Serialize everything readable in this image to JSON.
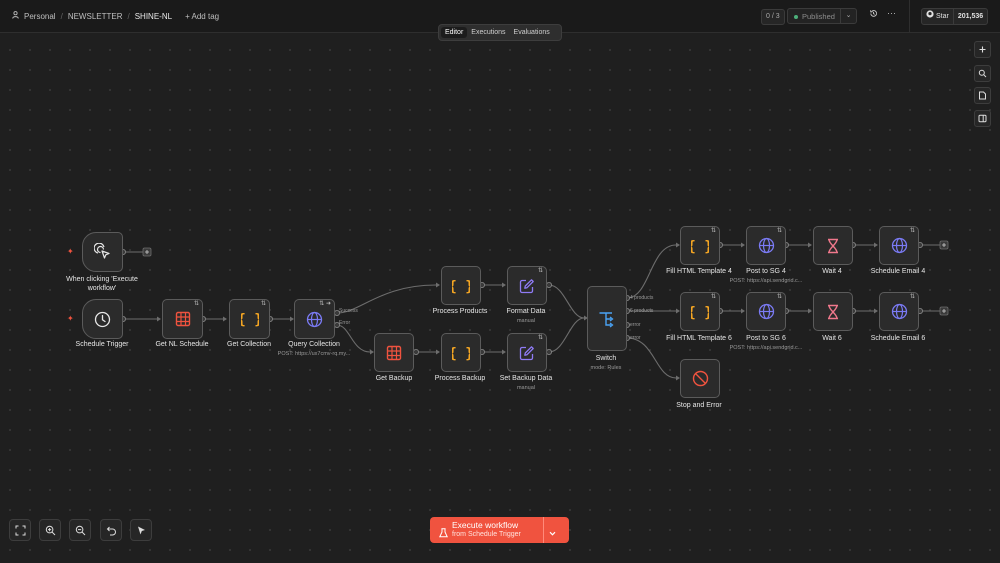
{
  "breadcrumb": {
    "personal": "Personal",
    "project": "NEWSLETTER",
    "workflow": "SHINE-NL",
    "add_tag": "+ Add tag"
  },
  "header": {
    "counter": "0 / 3",
    "publish_label": "Published",
    "github_star_label": "Star",
    "github_star_count": "201,536"
  },
  "view_tabs": {
    "editor": "Editor",
    "executions": "Executions",
    "evaluations": "Evaluations",
    "active": "Editor"
  },
  "execute_button": {
    "label": "Execute workflow",
    "sublabel": "from Schedule Trigger"
  },
  "nodes": {
    "manual_trigger": {
      "label": "When clicking 'Execute workflow'",
      "icon": "pointer-click-icon"
    },
    "schedule_trigger": {
      "label": "Schedule Trigger",
      "icon": "clock-icon"
    },
    "get_nl_schedule": {
      "label": "Get NL Schedule",
      "icon": "table-icon"
    },
    "get_collection": {
      "label": "Get Collection",
      "icon": "braces-icon"
    },
    "query_collection": {
      "label": "Query Collection",
      "sublabel": "POST: https://ux7cmv-rq.my...",
      "icon": "globe-icon",
      "outputs": [
        "Success",
        "Error"
      ]
    },
    "process_products": {
      "label": "Process Products",
      "icon": "braces-icon"
    },
    "format_data": {
      "label": "Format Data",
      "sublabel": "manual",
      "icon": "edit-icon"
    },
    "get_backup": {
      "label": "Get Backup",
      "icon": "table-icon"
    },
    "process_backup": {
      "label": "Process Backup",
      "icon": "braces-icon"
    },
    "set_backup_data": {
      "label": "Set Backup Data",
      "sublabel": "manual",
      "icon": "edit-icon"
    },
    "switch": {
      "label": "Switch",
      "sublabel": "mode: Rules",
      "icon": "switch-icon",
      "outputs": [
        "4 products",
        "6 products",
        "error",
        "error"
      ]
    },
    "fill_html_4": {
      "label": "Fill HTML Template 4",
      "icon": "braces-icon"
    },
    "post_sg_4": {
      "label": "Post to SG 4",
      "sublabel": "POST: https://api.sendgrid.c...",
      "icon": "globe-icon"
    },
    "wait_4": {
      "label": "Wait 4",
      "icon": "hourglass-icon"
    },
    "schedule_email_4": {
      "label": "Schedule Email 4",
      "icon": "globe-icon"
    },
    "fill_html_6": {
      "label": "Fill HTML Template 6",
      "icon": "braces-icon"
    },
    "post_sg_6": {
      "label": "Post to SG 6",
      "sublabel": "POST: https://api.sendgrid.c...",
      "icon": "globe-icon"
    },
    "wait_6": {
      "label": "Wait 6",
      "icon": "hourglass-icon"
    },
    "schedule_email_6": {
      "label": "Schedule Email 6",
      "icon": "globe-icon"
    },
    "stop_and_error": {
      "label": "Stop and Error",
      "icon": "ban-icon"
    }
  },
  "colors": {
    "accent": "#f0533f",
    "braces": "#f5a623",
    "table": "#f0533f",
    "globe": "#7b7bf5",
    "edit": "#8f7bf5",
    "hourglass": "#f0788c",
    "switch": "#4aa3f5",
    "published_dot": "#4caf7a"
  }
}
